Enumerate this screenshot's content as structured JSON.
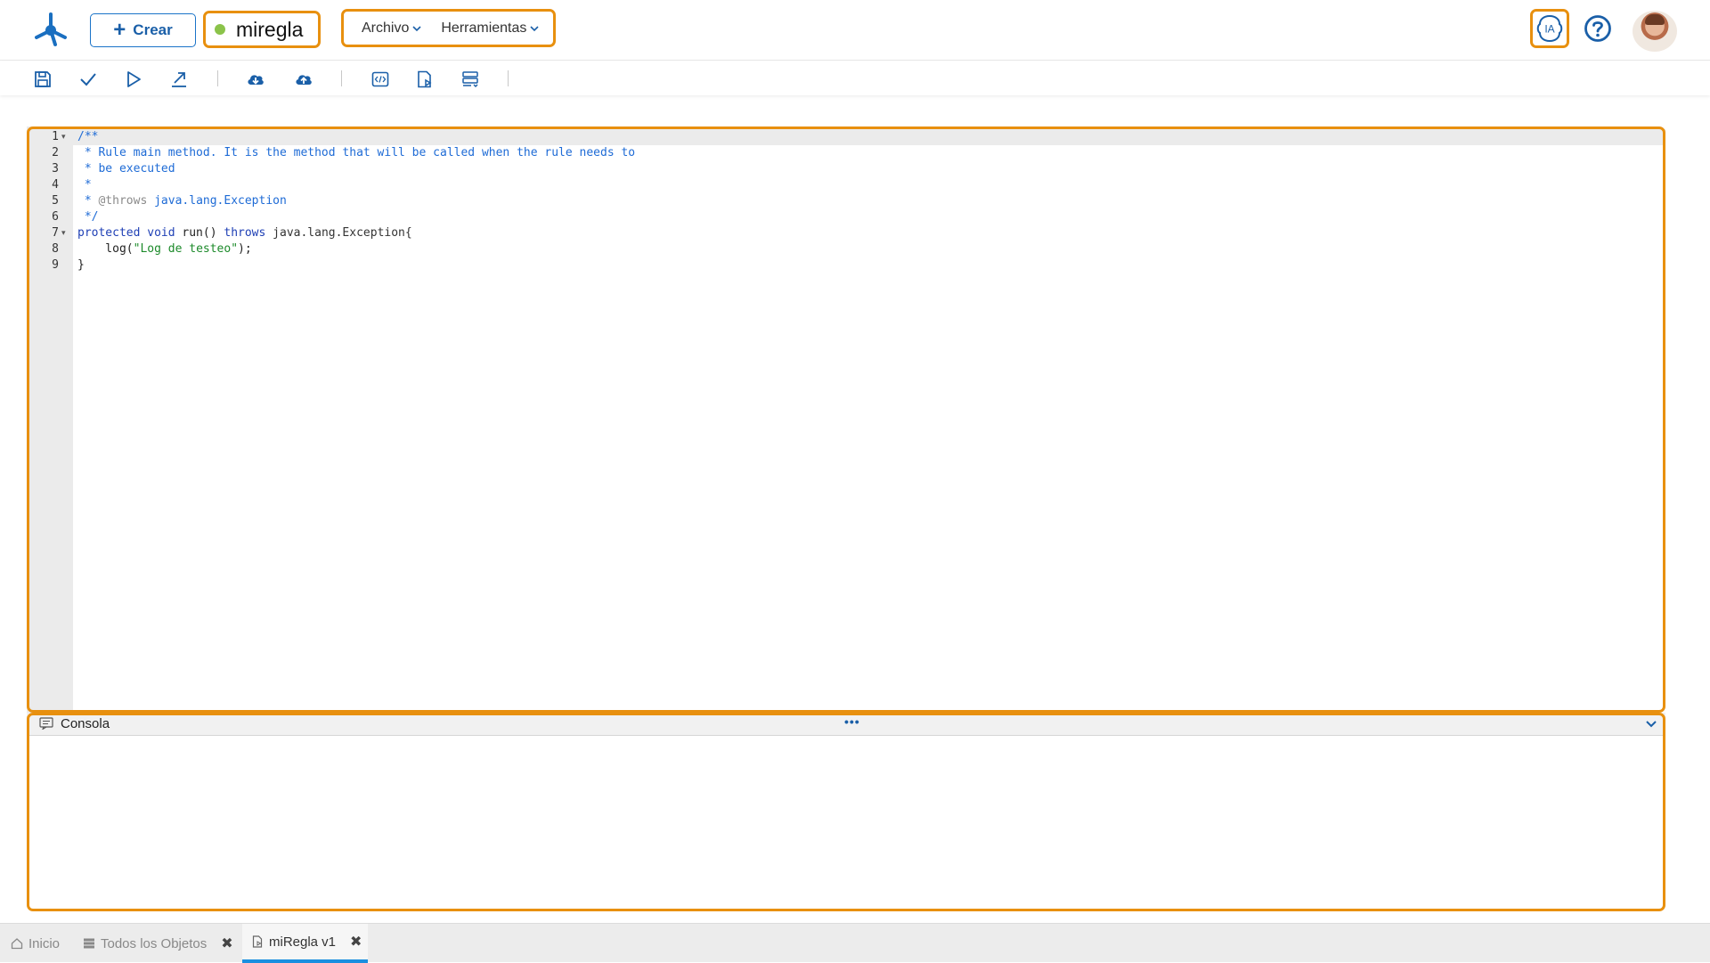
{
  "header": {
    "logo_icon": "deyel-logo-icon",
    "create_label": "Crear",
    "rule_name": "miregla",
    "status_color": "#8bc34a",
    "menus": [
      "Archivo",
      "Herramientas"
    ],
    "ia_label": "IA"
  },
  "toolbar": {
    "icons": [
      "save-icon",
      "check-icon",
      "run-icon",
      "export-icon",
      "cloud-download-icon",
      "cloud-upload-icon",
      "code-view-icon",
      "document-edit-icon",
      "list-icon"
    ]
  },
  "editor": {
    "line_numbers": [
      "1",
      "2",
      "3",
      "4",
      "5",
      "6",
      "7",
      "8",
      "9"
    ],
    "lines": {
      "l1": "/**",
      "l2": " * Rule main method. It is the method that will be called when the rule needs to",
      "l3": " * be executed",
      "l4": " *",
      "l5a": " * ",
      "l5b": "@throws",
      "l5c": " java.lang.Exception",
      "l6": " */",
      "l7a": "protected void",
      "l7b": " run() ",
      "l7c": "throws",
      "l7d": " java.lang.Exception{",
      "l8a": "    log(",
      "l8b": "\"Log de testeo\"",
      "l8c": ");",
      "l9": "}"
    }
  },
  "console": {
    "title": "Consola",
    "dots": "•••"
  },
  "tabs": {
    "home": "Inicio",
    "all_objects": "Todos los Objetos",
    "rule": "miRegla v1"
  },
  "colors": {
    "accent": "#1a5fa8",
    "highlight": "#e8900f",
    "active_tab": "#1a8fe0"
  }
}
